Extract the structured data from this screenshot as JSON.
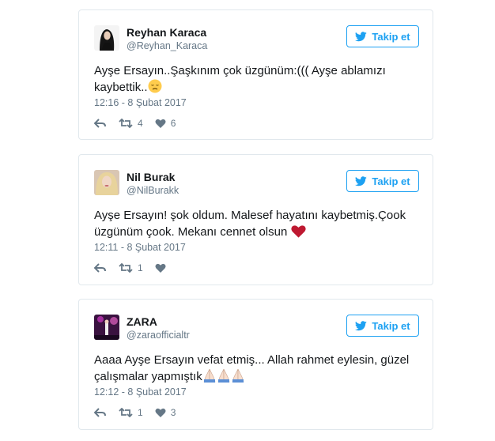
{
  "tweets": [
    {
      "name": "Reyhan Karaca",
      "handle": "@Reyhan_Karaca",
      "follow_label": "Takip et",
      "text_line1": "Ayşe Ersayın..Şaşkınım çok üzgünüm:((( Ayşe ablamızı",
      "text_line2": "kaybettik..",
      "emoji": "disappointed-face-icon",
      "time": "12:16 - 8 Şubat 2017",
      "retweets": "4",
      "likes": "6"
    },
    {
      "name": "Nil Burak",
      "handle": "@NilBurakk",
      "follow_label": "Takip et",
      "text_line1": "Ayşe Ersayın! şok oldum. Malesef hayatını kaybetmiş.Çook",
      "text_line2": "üzgünüm çook. Mekanı cennet olsun",
      "emoji": "red-heart-icon",
      "time": "12:11 - 8 Şubat 2017",
      "retweets": "1",
      "likes": ""
    },
    {
      "name": "ZARA",
      "handle": "@zaraofficialtr",
      "follow_label": "Takip et",
      "text_line1": "Aaaa Ayşe Ersayın vefat etmiş... Allah rahmet eylesin, güzel",
      "text_line2": "çalışmalar yapmıştık",
      "emoji": "folded-hands-icon",
      "time": "12:12 - 8 Şubat 2017",
      "retweets": "1",
      "likes": "3"
    }
  ],
  "colors": {
    "accent": "#1da1f2",
    "muted": "#657786",
    "border": "#e1e8ed"
  }
}
